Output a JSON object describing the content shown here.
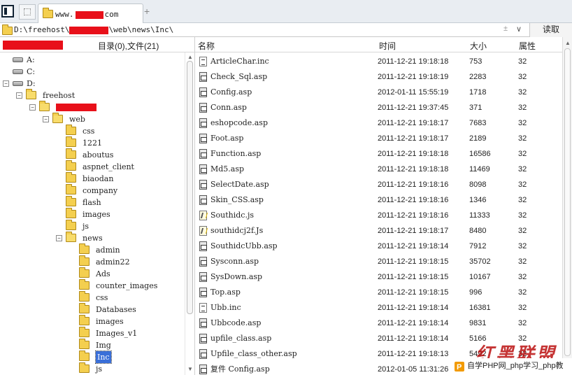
{
  "tab": {
    "title_prefix": "www.",
    "title_suffix": "com"
  },
  "address": {
    "prefix": "D:\\freehost\\",
    "suffix": "\\web\\news\\Inc\\",
    "go_label": "读取"
  },
  "left_header": {
    "dir_count": "目录(0),文件(21)"
  },
  "columns": {
    "name": "名称",
    "time": "时间",
    "size": "大小",
    "attr": "属性"
  },
  "tree": [
    {
      "label": "A:",
      "level": 0,
      "type": "drive"
    },
    {
      "label": "C:",
      "level": 0,
      "type": "drive"
    },
    {
      "label": "D:",
      "level": 0,
      "type": "drive",
      "toggle": "−"
    },
    {
      "label": "freehost",
      "level": 1,
      "type": "folder",
      "toggle": "−"
    },
    {
      "label": "",
      "level": 2,
      "type": "folder",
      "toggle": "−",
      "redacted": true
    },
    {
      "label": "web",
      "level": 3,
      "type": "folder",
      "toggle": "−"
    },
    {
      "label": "css",
      "level": 4,
      "type": "folder"
    },
    {
      "label": "1221",
      "level": 4,
      "type": "folder"
    },
    {
      "label": "aboutus",
      "level": 4,
      "type": "folder"
    },
    {
      "label": "aspnet_client",
      "level": 4,
      "type": "folder"
    },
    {
      "label": "biaodan",
      "level": 4,
      "type": "folder"
    },
    {
      "label": "company",
      "level": 4,
      "type": "folder"
    },
    {
      "label": "flash",
      "level": 4,
      "type": "folder"
    },
    {
      "label": "images",
      "level": 4,
      "type": "folder"
    },
    {
      "label": "js",
      "level": 4,
      "type": "folder"
    },
    {
      "label": "news",
      "level": 4,
      "type": "folder",
      "toggle": "−"
    },
    {
      "label": "admin",
      "level": 5,
      "type": "folder"
    },
    {
      "label": "admin22",
      "level": 5,
      "type": "folder"
    },
    {
      "label": "Ads",
      "level": 5,
      "type": "folder"
    },
    {
      "label": "counter_images",
      "level": 5,
      "type": "folder"
    },
    {
      "label": "css",
      "level": 5,
      "type": "folder"
    },
    {
      "label": "Databases",
      "level": 5,
      "type": "folder"
    },
    {
      "label": "images",
      "level": 5,
      "type": "folder"
    },
    {
      "label": "Images_v1",
      "level": 5,
      "type": "folder"
    },
    {
      "label": "Img",
      "level": 5,
      "type": "folder"
    },
    {
      "label": "Inc",
      "level": 5,
      "type": "folder",
      "selected": true
    },
    {
      "label": "js",
      "level": 5,
      "type": "folder"
    }
  ],
  "files": [
    {
      "name": "ArticleChar.inc",
      "time": "2011-12-21 19:18:18",
      "size": "753",
      "attr": "32",
      "icon": "inc"
    },
    {
      "name": "Check_Sql.asp",
      "time": "2011-12-21 19:18:19",
      "size": "2283",
      "attr": "32",
      "icon": "asp"
    },
    {
      "name": "Config.asp",
      "time": "2012-01-11 15:55:19",
      "size": "1718",
      "attr": "32",
      "icon": "asp"
    },
    {
      "name": "Conn.asp",
      "time": "2011-12-21 19:37:45",
      "size": "371",
      "attr": "32",
      "icon": "asp"
    },
    {
      "name": "eshopcode.asp",
      "time": "2011-12-21 19:18:17",
      "size": "7683",
      "attr": "32",
      "icon": "asp"
    },
    {
      "name": "Foot.asp",
      "time": "2011-12-21 19:18:17",
      "size": "2189",
      "attr": "32",
      "icon": "asp"
    },
    {
      "name": "Function.asp",
      "time": "2011-12-21 19:18:18",
      "size": "16586",
      "attr": "32",
      "icon": "asp"
    },
    {
      "name": "Md5.asp",
      "time": "2011-12-21 19:18:18",
      "size": "11469",
      "attr": "32",
      "icon": "asp"
    },
    {
      "name": "SelectDate.asp",
      "time": "2011-12-21 19:18:16",
      "size": "8098",
      "attr": "32",
      "icon": "asp"
    },
    {
      "name": "Skin_CSS.asp",
      "time": "2011-12-21 19:18:16",
      "size": "1346",
      "attr": "32",
      "icon": "asp"
    },
    {
      "name": "Southidc.js",
      "time": "2011-12-21 19:18:16",
      "size": "11333",
      "attr": "32",
      "icon": "js"
    },
    {
      "name": "southidcj2f.Js",
      "time": "2011-12-21 19:18:17",
      "size": "8480",
      "attr": "32",
      "icon": "js"
    },
    {
      "name": "SouthidcUbb.asp",
      "time": "2011-12-21 19:18:14",
      "size": "7912",
      "attr": "32",
      "icon": "asp"
    },
    {
      "name": "Sysconn.asp",
      "time": "2011-12-21 19:18:15",
      "size": "35702",
      "attr": "32",
      "icon": "asp"
    },
    {
      "name": "SysDown.asp",
      "time": "2011-12-21 19:18:15",
      "size": "10167",
      "attr": "32",
      "icon": "asp"
    },
    {
      "name": "Top.asp",
      "time": "2011-12-21 19:18:15",
      "size": "996",
      "attr": "32",
      "icon": "asp"
    },
    {
      "name": "Ubb.inc",
      "time": "2011-12-21 19:18:14",
      "size": "16381",
      "attr": "32",
      "icon": "inc"
    },
    {
      "name": "Ubbcode.asp",
      "time": "2011-12-21 19:18:14",
      "size": "9831",
      "attr": "32",
      "icon": "asp"
    },
    {
      "name": "upfile_class.asp",
      "time": "2011-12-21 19:18:14",
      "size": "5166",
      "attr": "32",
      "icon": "asp"
    },
    {
      "name": "Upfile_class_other.asp",
      "time": "2011-12-21 19:18:13",
      "size": "5492",
      "attr": "32",
      "icon": "asp"
    },
    {
      "name": "复件 Config.asp",
      "time": "2012-01-05 11:31:26",
      "size": "",
      "attr": "",
      "icon": "asp"
    }
  ],
  "overlay": {
    "watermark": "红黑联盟",
    "brand_text": "自学PHP网_php学习_php教"
  }
}
